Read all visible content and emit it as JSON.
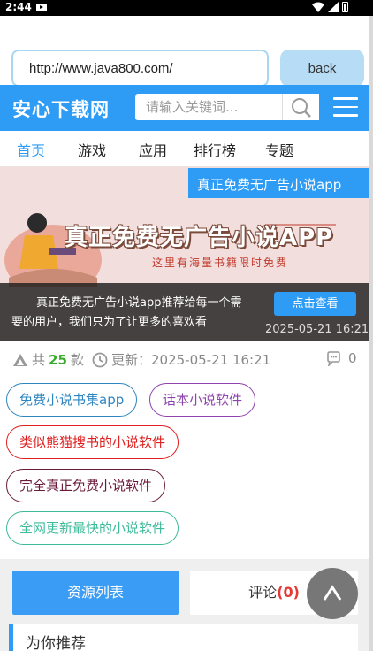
{
  "status_bar": {
    "time": "2:44",
    "icons": [
      "notification-icon",
      "wifi-icon",
      "signal-icon",
      "battery-icon"
    ]
  },
  "browser": {
    "url_value": "http://www.java800.com/",
    "back_label": "back"
  },
  "header": {
    "logo": "安心下载网",
    "search_placeholder": "请输入关键词...",
    "search_icon": "search-icon",
    "menu_icon": "menu-icon"
  },
  "nav": {
    "items": [
      {
        "label": "首页",
        "active": true
      },
      {
        "label": "游戏"
      },
      {
        "label": "应用"
      },
      {
        "label": "排行榜"
      },
      {
        "label": "专题"
      }
    ]
  },
  "banner": {
    "tag": "真正免费无广告小说app",
    "headline": "真正免费无广告小说APP",
    "subline": "这里有海量书籍限时免费",
    "description": "真正免费无广告小说app推荐给每一个需要的用户，我们只为了让更多的喜欢看",
    "view_button": "点击查看",
    "date": "2025-05-21 16:21"
  },
  "meta": {
    "count_prefix": "共",
    "count": "25",
    "count_suffix": "款",
    "update_label": "更新：2025-05-21 16:21",
    "comments": "0"
  },
  "tags": [
    {
      "label": "免费小说书集app",
      "color": "#2e86c1"
    },
    {
      "label": "话本小说软件",
      "color": "#8e44ad"
    },
    {
      "label": "类似熊猫搜书的小说软件",
      "color": "#e02020"
    },
    {
      "label": "完全真正免费小说软件",
      "color": "#6b1a3a"
    },
    {
      "label": "全网更新最快的小说软件",
      "color": "#3dbb9a"
    }
  ],
  "tabs": {
    "list_label": "资源列表",
    "comment_label": "评论",
    "comment_count": "(0)"
  },
  "recommend": {
    "title": "为你推荐"
  },
  "colors": {
    "brand_blue": "#2e9bf5",
    "count_green": "#3aab2e",
    "comment_red": "#e53935"
  }
}
